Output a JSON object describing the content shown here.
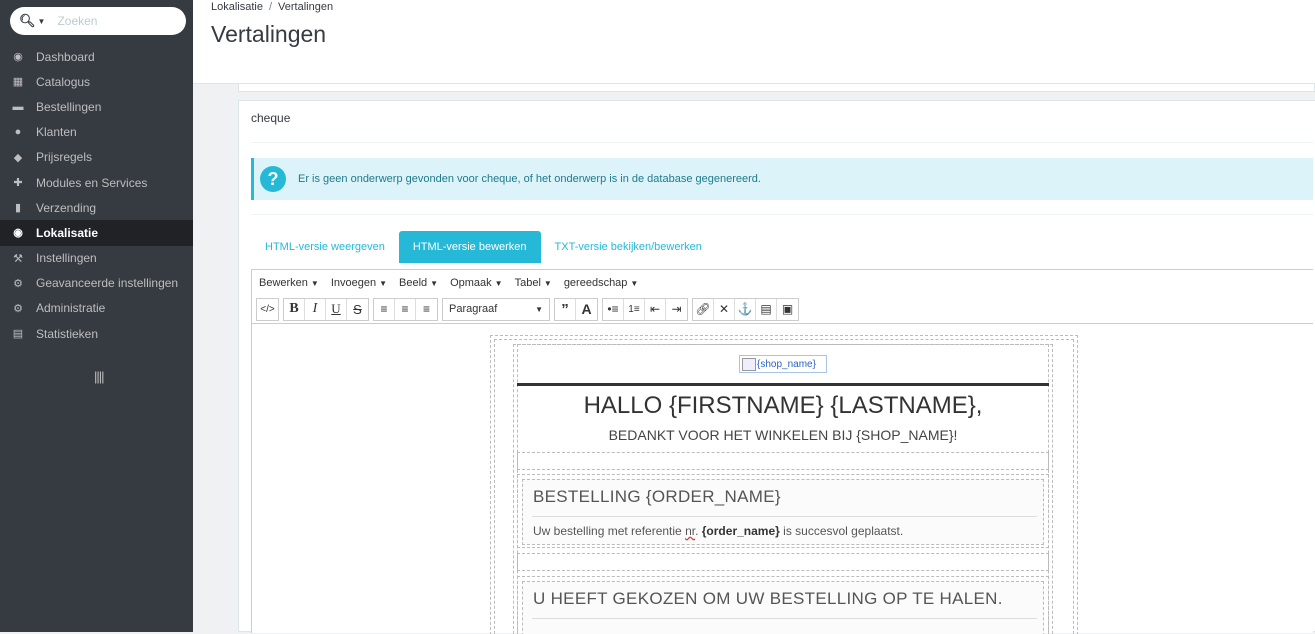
{
  "search": {
    "placeholder": "Zoeken"
  },
  "sidebar": {
    "items": [
      {
        "label": "Dashboard",
        "icon": "dashboard-icon"
      },
      {
        "label": "Catalogus",
        "icon": "book-icon"
      },
      {
        "label": "Bestellingen",
        "icon": "credit-card-icon"
      },
      {
        "label": "Klanten",
        "icon": "users-icon"
      },
      {
        "label": "Prijsregels",
        "icon": "tags-icon"
      },
      {
        "label": "Modules en Services",
        "icon": "puzzle-icon"
      },
      {
        "label": "Verzending",
        "icon": "truck-icon"
      },
      {
        "label": "Lokalisatie",
        "icon": "globe-icon",
        "active": true
      },
      {
        "label": "Instellingen",
        "icon": "wrench-icon"
      },
      {
        "label": "Geavanceerde instellingen",
        "icon": "cogs-icon"
      },
      {
        "label": "Administratie",
        "icon": "gear-icon"
      },
      {
        "label": "Statistieken",
        "icon": "bar-chart-icon"
      }
    ]
  },
  "header": {
    "breadcrumb": [
      "Lokalisatie",
      "Vertalingen"
    ],
    "title": "Vertalingen"
  },
  "panel": {
    "heading": "cheque",
    "alert": "Er is geen onderwerp gevonden voor cheque, of het onderwerp is in de database gegenereerd.",
    "tabs": [
      "HTML-versie weergeven",
      "HTML-versie bewerken",
      "TXT-versie bekijken/bewerken"
    ],
    "active_tab": 1
  },
  "editor": {
    "menu": [
      "Bewerken",
      "Invoegen",
      "Beeld",
      "Opmaak",
      "Tabel",
      "gereedschap"
    ],
    "format_select": "Paragraaf",
    "email": {
      "logo_alt": "{shop_name}",
      "greeting": "HALLO {FIRSTNAME} {LASTNAME},",
      "thanks": "BEDANKT VOOR HET WINKELEN BIJ {SHOP_NAME}!",
      "order_title": "BESTELLING {ORDER_NAME}",
      "order_text_pre": "Uw bestelling met referentie ",
      "order_text_nr": "nr",
      "order_text_dot": ". ",
      "order_text_bold": "{order_name}",
      "order_text_post": " is succesvol geplaatst.",
      "pickup_title": "U HEEFT GEKOZEN OM UW BESTELLING OP TE HALEN."
    }
  },
  "colors": {
    "accent": "#25b9d7",
    "sidebar": "#363a41",
    "active": "#202226"
  }
}
